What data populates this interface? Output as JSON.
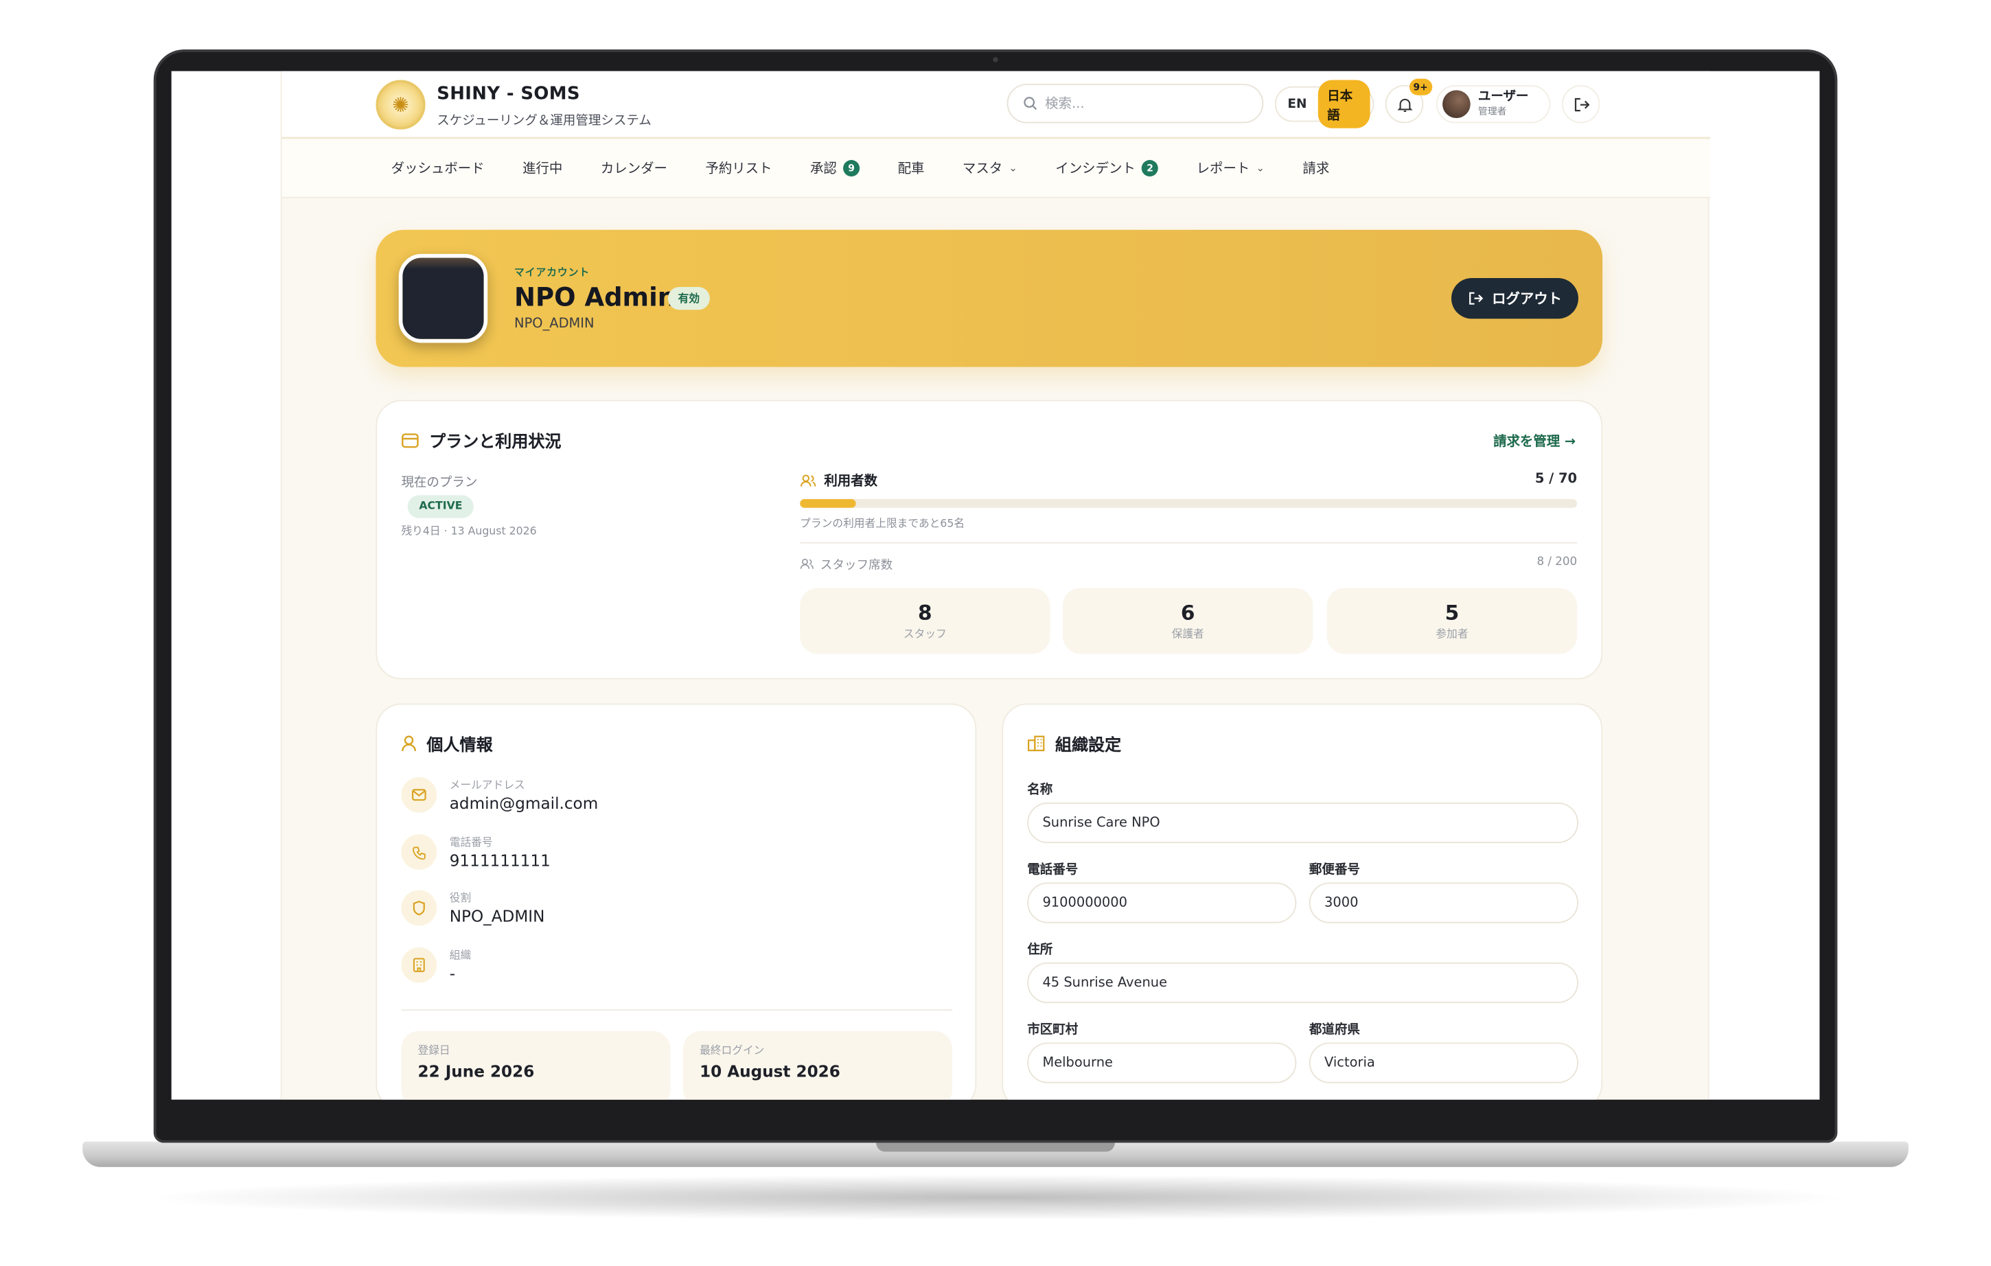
{
  "brand": {
    "title": "SHINY - SOMS",
    "subtitle": "スケジューリング＆運用管理システム"
  },
  "header": {
    "search_placeholder": "検索...",
    "lang_en": "EN",
    "lang_ja": "日本語",
    "notif_count": "9+",
    "user_name": "ユーザー",
    "user_role": "管理者"
  },
  "nav": [
    {
      "label": "ダッシュボード"
    },
    {
      "label": "進行中"
    },
    {
      "label": "カレンダー"
    },
    {
      "label": "予約リスト"
    },
    {
      "label": "承認",
      "badge": "9"
    },
    {
      "label": "配車"
    },
    {
      "label": "マスタ",
      "dropdown": true
    },
    {
      "label": "インシデント",
      "badge": "2"
    },
    {
      "label": "レポート",
      "dropdown": true
    },
    {
      "label": "請求"
    }
  ],
  "hero": {
    "eyebrow": "マイアカウント",
    "name": "NPO Admin",
    "status": "有効",
    "role": "NPO_ADMIN",
    "logout": "ログアウト"
  },
  "plan": {
    "title": "プランと利用状況",
    "manage": "請求を管理 →",
    "current_label": "現在のプラン",
    "status": "ACTIVE",
    "remaining": "残り4日 · 13 August 2026",
    "users_label": "利用者数",
    "users_count": "5 / 70",
    "users_fraction": 0.0714,
    "users_note": "プランの利用者上限まであと65名",
    "staff_label": "スタッフ席数",
    "staff_count": "8 / 200",
    "stats": [
      {
        "n": "8",
        "t": "スタッフ"
      },
      {
        "n": "6",
        "t": "保護者"
      },
      {
        "n": "5",
        "t": "参加者"
      }
    ]
  },
  "personal": {
    "title": "個人情報",
    "rows": [
      {
        "label": "メールアドレス",
        "value": "admin@gmail.com",
        "icon": "mail-icon"
      },
      {
        "label": "電話番号",
        "value": "9111111111",
        "icon": "phone-icon"
      },
      {
        "label": "役割",
        "value": "NPO_ADMIN",
        "icon": "shield-icon"
      },
      {
        "label": "組織",
        "value": "-",
        "icon": "building-icon"
      }
    ],
    "registered_label": "登録日",
    "registered": "22 June 2026",
    "last_login_label": "最終ログイン",
    "last_login": "10 August 2026"
  },
  "org": {
    "title": "組織設定",
    "name_label": "名称",
    "name": "Sunrise Care NPO",
    "phone_label": "電話番号",
    "phone": "9100000000",
    "postal_label": "郵便番号",
    "postal": "3000",
    "address_label": "住所",
    "address": "45 Sunrise Avenue",
    "city_label": "市区町村",
    "city": "Melbourne",
    "state_label": "都道府県",
    "state": "Victoria"
  },
  "colors": {
    "accent": "#f4b522",
    "green": "#1f7a5e",
    "dark": "#1e2a35"
  }
}
